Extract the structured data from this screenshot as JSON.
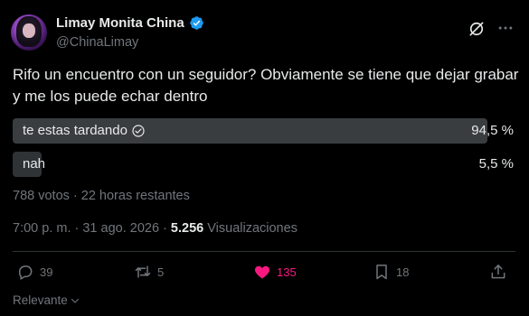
{
  "author": {
    "name": "Limay Monita China",
    "handle": "@ChinaLimay"
  },
  "tweet": {
    "text": "Rifo un encuentro con un seguidor? Obviamente se tiene que dejar grabar y me los puede echar dentro"
  },
  "poll": {
    "options": [
      {
        "label": "te estas tardando",
        "percent": "94,5 %",
        "fraction": 0.945,
        "selected": true
      },
      {
        "label": "nah",
        "percent": "5,5 %",
        "fraction": 0.055,
        "selected": false
      }
    ],
    "meta": "788 votos · 22 horas restantes"
  },
  "timestamp": {
    "time_date": "7:00 p. m. · 31 ago. 2026 · ",
    "views_count": "5.256",
    "views_label": " Visualizaciones"
  },
  "actions": {
    "replies": "39",
    "reposts": "5",
    "likes": "135",
    "bookmarks": "18"
  },
  "sort": {
    "label": "Relevante"
  },
  "colors": {
    "background": "#000000",
    "text": "#e7e9ea",
    "muted": "#71767b",
    "like_active": "#f91880",
    "verified": "#1d9bf0"
  }
}
